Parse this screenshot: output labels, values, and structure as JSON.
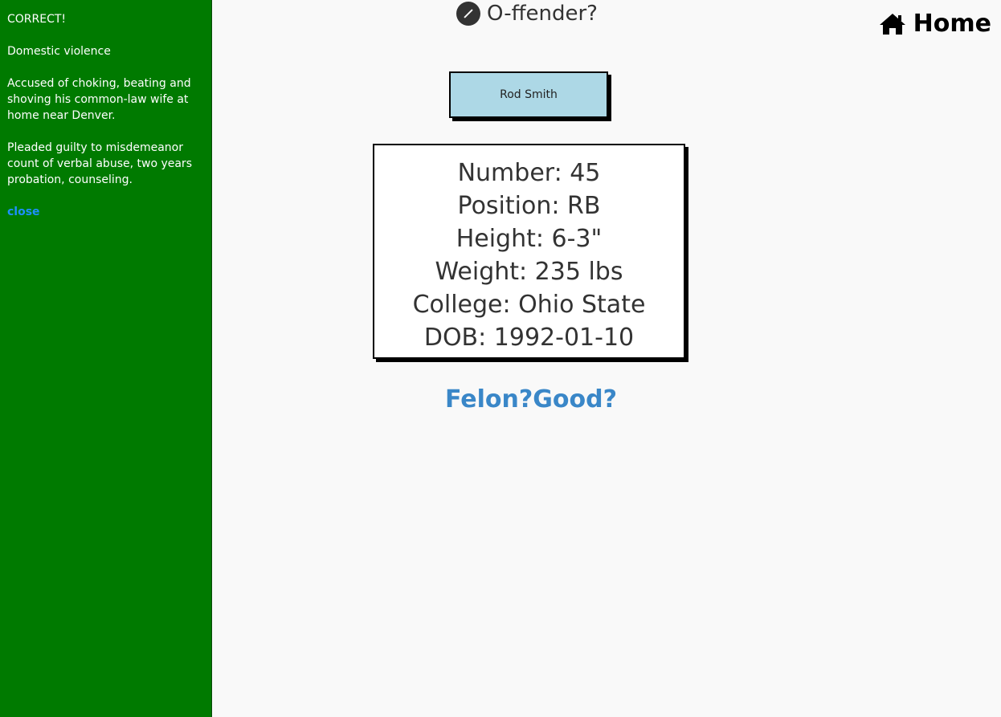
{
  "sidebar": {
    "status": "CORRECT!",
    "offense": "Domestic violence",
    "accusation": "Accused of choking, beating and shoving his common-law wife at home near Denver.",
    "outcome": "Pleaded guilty to misdemeanor count of verbal abuse, two years probation, counseling.",
    "close_label": "close",
    "background_color": "#007a00"
  },
  "header": {
    "title": "O-ffender?",
    "title_icon": "football-icon",
    "home_label": "Home",
    "home_icon": "house-icon"
  },
  "player": {
    "name": "Rod Smith",
    "number": "Number: 45",
    "position": "Position: RB",
    "height": "Height: 6-3\"",
    "weight": "Weight: 235 lbs",
    "college": "College: Ohio State",
    "dob": "DOB: 1992-01-10"
  },
  "choices": {
    "felon_label": "Felon?",
    "good_label": "Good?",
    "color": "#3a87c8"
  }
}
